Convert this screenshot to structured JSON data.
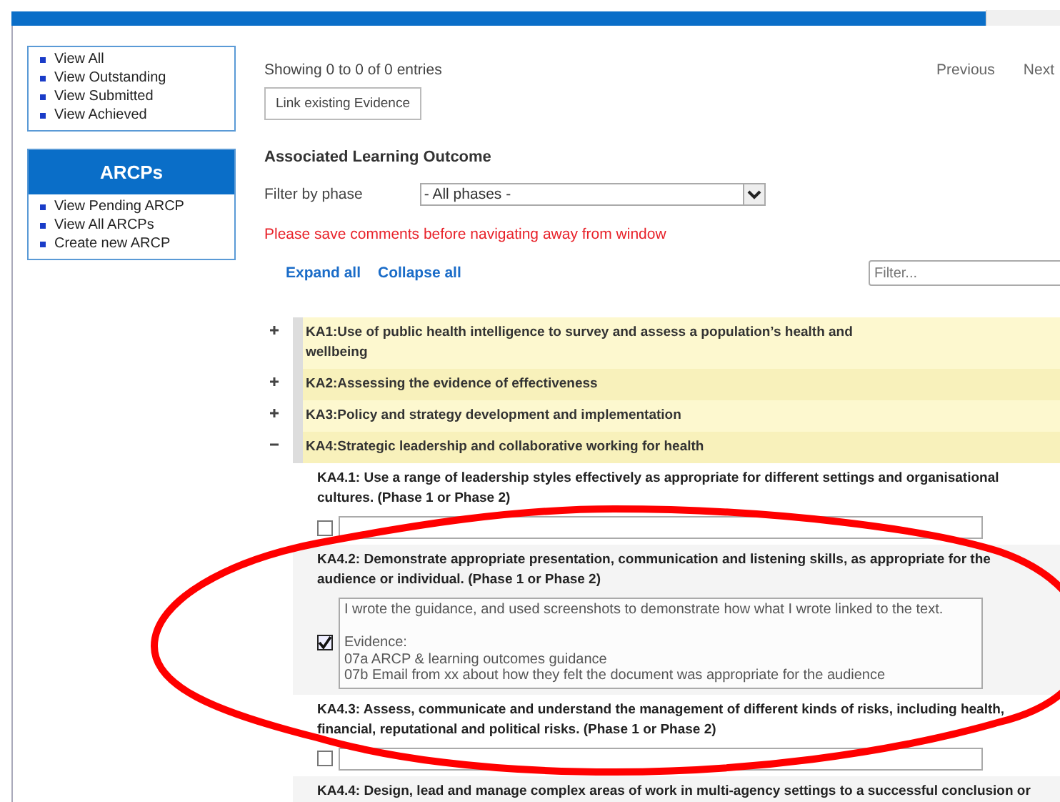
{
  "sidebar": {
    "evidence_links": [
      "View All",
      "View Outstanding",
      "View Submitted",
      "View Achieved"
    ],
    "arcps": {
      "title": "ARCPs",
      "links": [
        "View Pending ARCP",
        "View All ARCPs",
        "Create new ARCP"
      ]
    }
  },
  "main": {
    "entries_info": "Showing 0 to 0 of 0 entries",
    "pager": [
      "Previous",
      "Next"
    ],
    "link_button": "Link existing Evidence",
    "heading": "Associated Learning Outcome",
    "filter_label": "Filter by phase",
    "phase_select": "- All phases -",
    "warning": "Please save comments before navigating away from window",
    "expand_all": "Expand all",
    "collapse_all": "Collapse all",
    "filter": {
      "placeholder": "Filter..."
    },
    "outcomes": [
      {
        "title": "KA1:Use of public health intelligence to survey and assess a population’s health and wellbeing",
        "expanded": false
      },
      {
        "title": "KA2:Assessing the evidence of effectiveness",
        "expanded": false
      },
      {
        "title": "KA3:Policy and strategy development and implementation",
        "expanded": false
      },
      {
        "title": "KA4:Strategic leadership and collaborative working for health",
        "expanded": true,
        "children": [
          {
            "title": "KA4.1: Use a range of leadership styles effectively as appropriate for different settings and organisational cultures. (Phase 1 or Phase 2)",
            "checked": false
          },
          {
            "title": "KA4.2: Demonstrate appropriate presentation, communication and listening skills, as appropriate for the audience or individual. (Phase 1 or Phase 2)",
            "checked": true,
            "comment": "I wrote the guidance, and used screenshots to demonstrate how what I wrote linked to the text.\n\nEvidence:\n07a ARCP & learning outcomes guidance\n07b Email from xx about how they felt the document was appropriate for the audience"
          },
          {
            "title": "KA4.3: Assess, communicate and understand the management of different kinds of risks, including health, financial, reputational and political risks. (Phase 1 or Phase 2)",
            "checked": false
          },
          {
            "title": "KA4.4: Design, lead and manage complex areas of work in multi-agency settings to a successful conclusion or"
          }
        ]
      }
    ]
  }
}
